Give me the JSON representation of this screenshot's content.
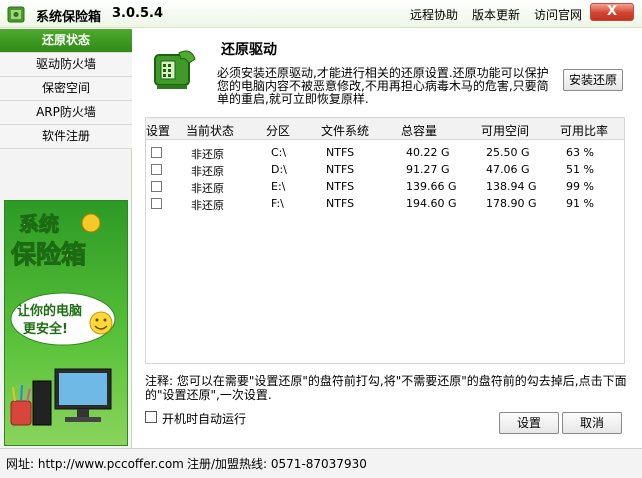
{
  "app": {
    "title": "系统保险箱",
    "version": "3.0.5.4",
    "close_label": "X"
  },
  "toplinks": [
    "远程协助",
    "版本更新",
    "访问官网"
  ],
  "sidebar": {
    "items": [
      {
        "label": "还原状态",
        "active": true
      },
      {
        "label": "驱动防火墙",
        "active": false
      },
      {
        "label": "保密空间",
        "active": false
      },
      {
        "label": "ARP防火墙",
        "active": false
      },
      {
        "label": "软件注册",
        "active": false
      }
    ],
    "banner": {
      "line1": "系统",
      "line2": "保险箱",
      "slogan1": "让你的电脑",
      "slogan2": "更安全!"
    }
  },
  "main": {
    "title": "还原驱动",
    "description": "必须安装还原驱动,才能进行相关的还原设置.还原功能可以保护您的电脑内容不被恶意修改,不用再担心病毒木马的危害,只要简单的重启,就可立即恢复原样.",
    "install_button": "安装还原",
    "table": {
      "headers": [
        "设置",
        "当前状态",
        "分区",
        "文件系统",
        "总容量",
        "可用空间",
        "可用比率"
      ],
      "rows": [
        {
          "checked": false,
          "status": "非还原",
          "partition": "C:\\",
          "fs": "NTFS",
          "total": "40.22 G",
          "free": "25.50 G",
          "ratio": "63 %"
        },
        {
          "checked": false,
          "status": "非还原",
          "partition": "D:\\",
          "fs": "NTFS",
          "total": "91.27 G",
          "free": "47.06 G",
          "ratio": "51 %"
        },
        {
          "checked": false,
          "status": "非还原",
          "partition": "E:\\",
          "fs": "NTFS",
          "total": "139.66 G",
          "free": "138.94 G",
          "ratio": "99 %"
        },
        {
          "checked": false,
          "status": "非还原",
          "partition": "F:\\",
          "fs": "NTFS",
          "total": "194.60 G",
          "free": "178.90 G",
          "ratio": "91 %"
        }
      ]
    },
    "note": "注释: 您可以在需要\"设置还原\"的盘符前打勾,将\"不需要还原\"的盘符前的勾去掉后,点击下面的\"设置还原\",一次设置.",
    "autorun_label": "开机时自动运行",
    "autorun_checked": false,
    "buttons": {
      "apply": "设置",
      "cancel": "取消"
    }
  },
  "status": {
    "url": "网址: http://www.pccoffer.com",
    "hotline": "注册/加盟热线: 0571-87037930"
  },
  "colors": {
    "accent": "#2f8a17",
    "close": "#d4442f"
  }
}
